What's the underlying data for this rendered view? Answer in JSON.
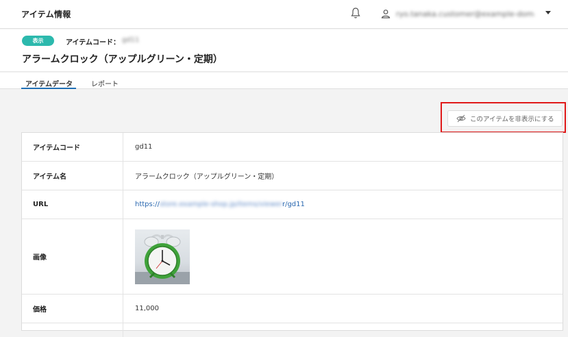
{
  "app": {
    "title": "アイテム情報"
  },
  "user": {
    "email": "ryo.tanaka.customer@example-domain.co.jp"
  },
  "header": {
    "badge": "表示",
    "item_code_label": "アイテムコード：",
    "item_code_value": "gd11",
    "item_title": "アラームクロック（アップルグリーン・定期）"
  },
  "tabs": [
    {
      "label": "アイテムデータ",
      "active": true
    },
    {
      "label": "レポート",
      "active": false
    }
  ],
  "actions": {
    "hide_label": "このアイテムを非表示にする"
  },
  "fields": [
    {
      "key": "アイテムコード",
      "value": "gd11"
    },
    {
      "key": "アイテム名",
      "value": "アラームクロック（アップルグリーン・定期）"
    },
    {
      "key": "URL",
      "prefix": "https://",
      "hidden": "store.example-shop.jp/items/viewer",
      "suffix": "r/gd11"
    },
    {
      "key": "画像",
      "value": "alarm-clock-image"
    },
    {
      "key": "価格",
      "value": "11,000"
    }
  ],
  "colors": {
    "badge": "#2cb9ad",
    "tab_underline": "#1f6fb5",
    "highlight": "#e01818",
    "link": "#2a68b0"
  }
}
